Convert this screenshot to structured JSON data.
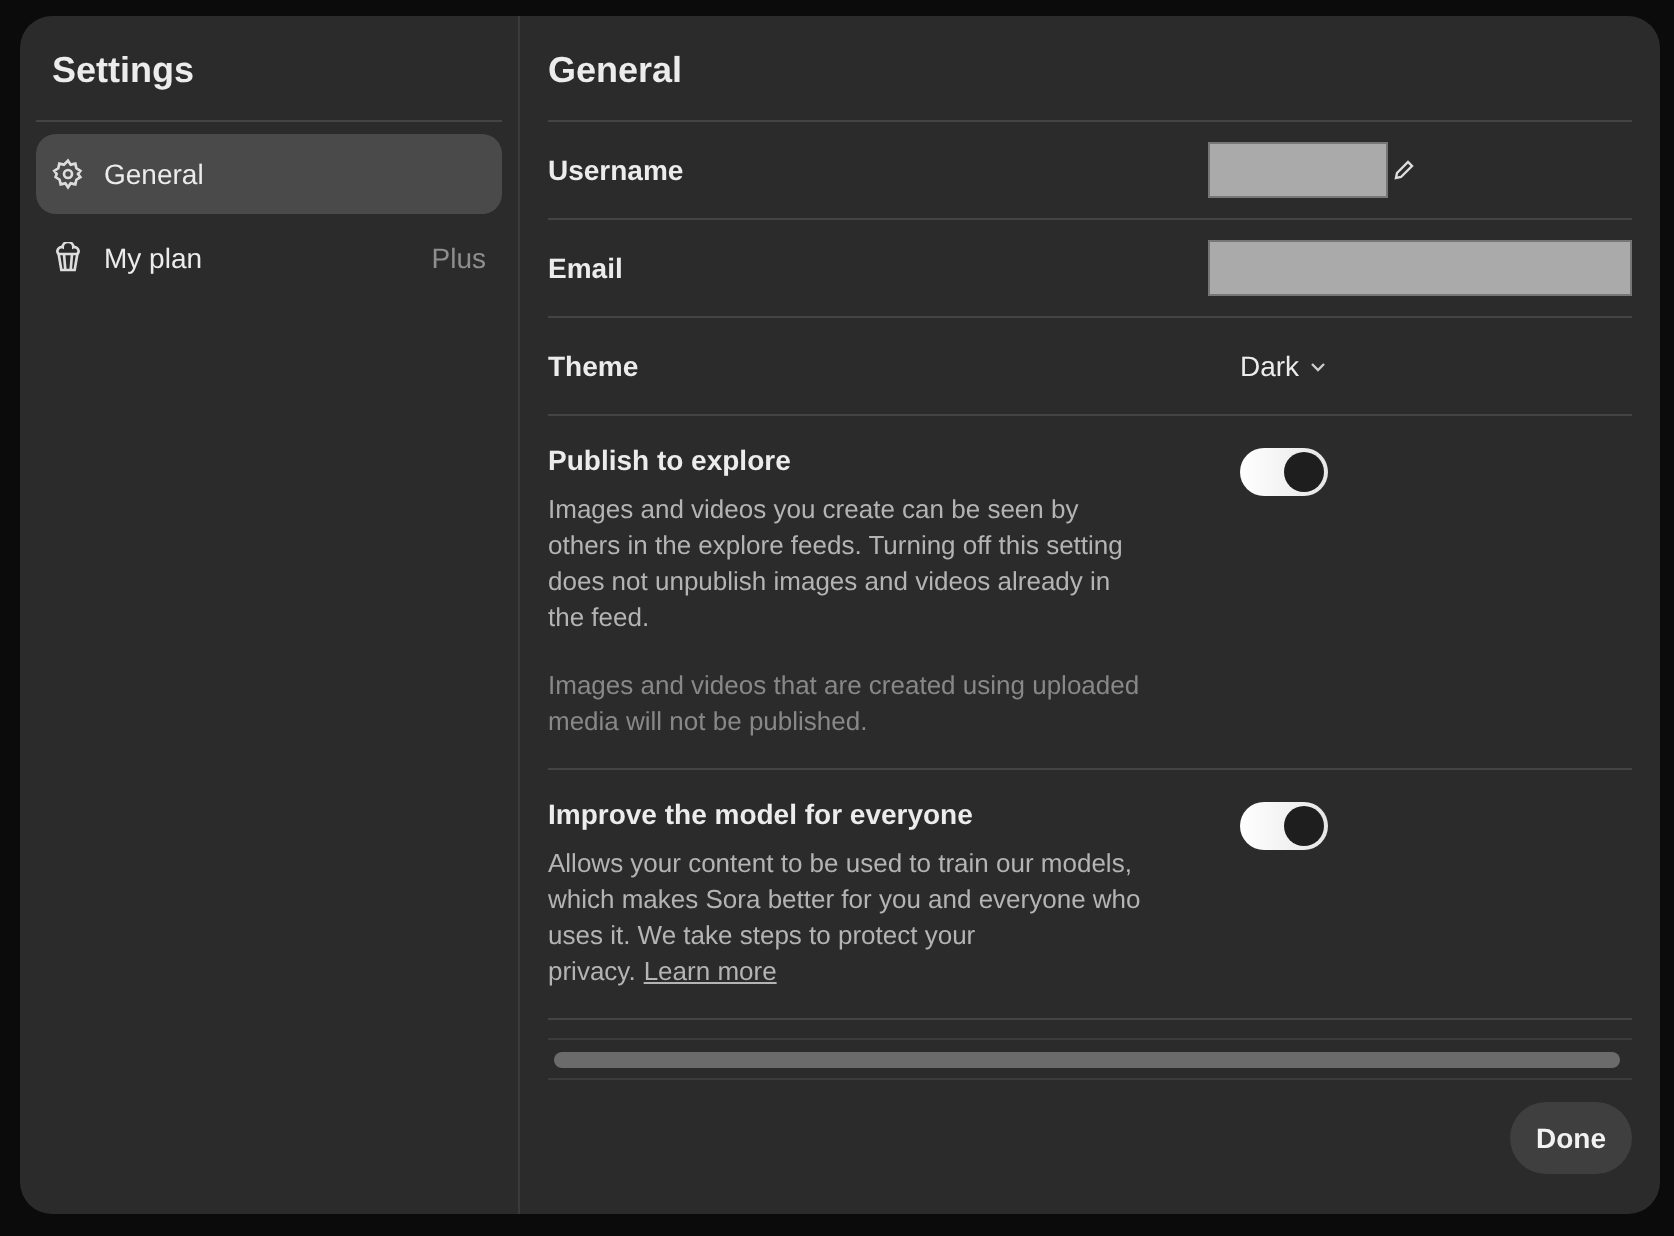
{
  "sidebar": {
    "title": "Settings",
    "items": [
      {
        "label": "General",
        "selected": true
      },
      {
        "label": "My plan",
        "selected": false,
        "badge": "Plus"
      }
    ]
  },
  "main": {
    "title": "General",
    "rows": [
      {
        "kind": "field",
        "label": "Username"
      },
      {
        "kind": "field",
        "label": "Email"
      },
      {
        "kind": "select",
        "label": "Theme",
        "value": "Dark"
      },
      {
        "kind": "toggle",
        "label": "Publish to explore",
        "on": true,
        "paragraphs": [
          {
            "text": "Images and videos you create can be seen by others in the explore feeds. Turning off this setting does not unpublish images and videos already in the feed."
          },
          {
            "text": "Images and videos that are created using uploaded media will not be published."
          }
        ]
      },
      {
        "kind": "toggle",
        "label": "Improve the model for everyone",
        "on": true,
        "paragraphs": [
          {
            "text": "Allows your content to be used to train our models, which makes Sora better for you and everyone who uses it. We take steps to protect your privacy.",
            "link": "Learn more"
          }
        ]
      }
    ]
  },
  "footer": {
    "button": "Done"
  }
}
